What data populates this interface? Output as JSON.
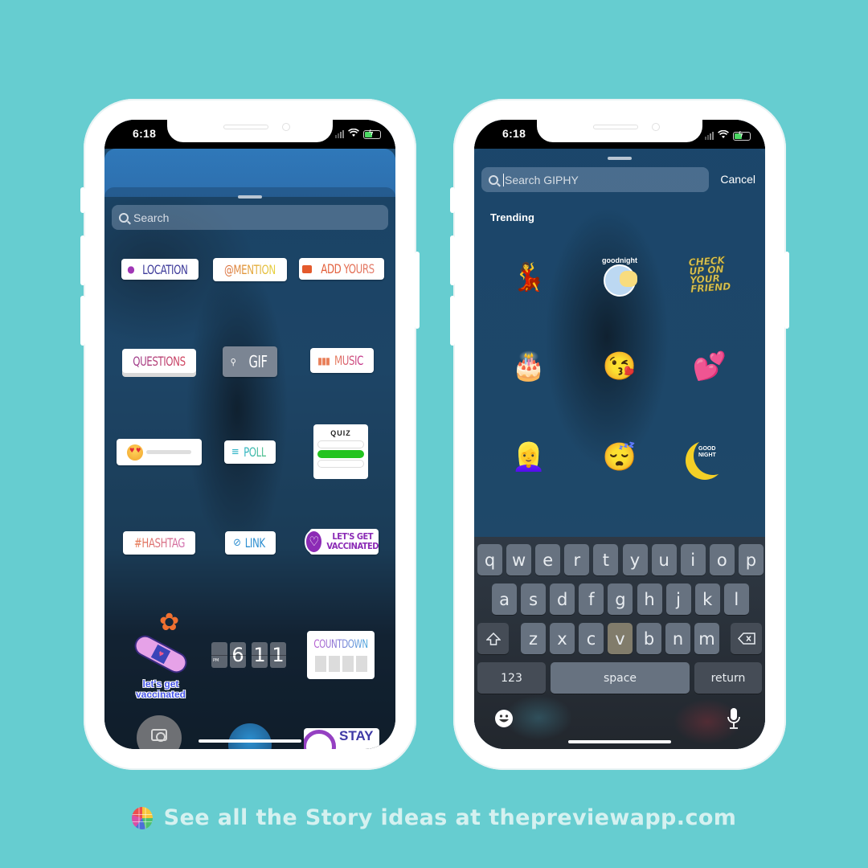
{
  "background_color": "#66cdd0",
  "left_phone": {
    "status_bar": {
      "time": "6:18",
      "icons": [
        "signal-icon",
        "wifi-icon",
        "battery-charging-icon"
      ]
    },
    "search": {
      "placeholder": "Search"
    },
    "stickers": [
      {
        "name": "location",
        "label": "LOCATION",
        "icon": "location-pin-icon"
      },
      {
        "name": "mention",
        "label": "@MENTION"
      },
      {
        "name": "add-yours",
        "label": "ADD YOURS",
        "icon": "camera-icon"
      },
      {
        "name": "questions",
        "label": "QUESTIONS"
      },
      {
        "name": "gif",
        "label": "GIF",
        "icon": "search-icon"
      },
      {
        "name": "music",
        "label": "MUSIC",
        "icon": "music-bars-icon"
      },
      {
        "name": "emoji-slider",
        "label": "",
        "icon": "heart-eyes-emoji-icon"
      },
      {
        "name": "poll",
        "label": "POLL",
        "icon": "poll-lines-icon"
      },
      {
        "name": "quiz",
        "label": "QUIZ"
      },
      {
        "name": "hashtag",
        "label": "#HASHTAG"
      },
      {
        "name": "link",
        "label": "LINK",
        "icon": "link-icon"
      },
      {
        "name": "lets-get-vaccinated-badge",
        "label_line1": "LET'S GET",
        "label_line2": "VACCINATED",
        "icon": "heart-icon"
      },
      {
        "name": "lets-get-vaccinated-art",
        "label_line1": "let's get",
        "label_line2": "vaccinated"
      },
      {
        "name": "time",
        "period": "PM",
        "hour": "6",
        "minute_1": "1",
        "minute_2": "1"
      },
      {
        "name": "countdown",
        "label": "COUNTDOWN"
      }
    ],
    "bottom_row": {
      "stay_home_label": "STAY"
    }
  },
  "right_phone": {
    "status_bar": {
      "time": "6:18"
    },
    "search": {
      "placeholder": "Search GIPHY",
      "value": ""
    },
    "cancel_label": "Cancel",
    "section_title": "Trending",
    "gifs": [
      {
        "name": "carnival-dancer",
        "glyph": "💃"
      },
      {
        "name": "goodnight-moon",
        "text": "goodnight"
      },
      {
        "name": "check-up-on-your-friend",
        "text_lines": [
          "CHECK",
          "UP ON",
          "YOUR",
          "FRIEND"
        ]
      },
      {
        "name": "birthday-cake",
        "glyph": "🎂"
      },
      {
        "name": "kissing-face",
        "glyph": "😘"
      },
      {
        "name": "hanging-hearts",
        "glyph": "💕"
      },
      {
        "name": "blonde-girl-hearts",
        "glyph": "👱‍♀️"
      },
      {
        "name": "sleeping-girl",
        "glyph": "😴"
      },
      {
        "name": "good-night-crescent",
        "text_lines": [
          "GOOD",
          "NIGHT"
        ]
      }
    ],
    "keyboard": {
      "row1": [
        "q",
        "w",
        "e",
        "r",
        "t",
        "y",
        "u",
        "i",
        "o",
        "p"
      ],
      "row2": [
        "a",
        "s",
        "d",
        "f",
        "g",
        "h",
        "j",
        "k",
        "l"
      ],
      "row3": [
        "z",
        "x",
        "c",
        "v",
        "b",
        "n",
        "m"
      ],
      "numbers_label": "123",
      "space_label": "space",
      "return_label": "return"
    }
  },
  "caption": {
    "text": "See all the Story ideas at thepreviewapp.com"
  }
}
